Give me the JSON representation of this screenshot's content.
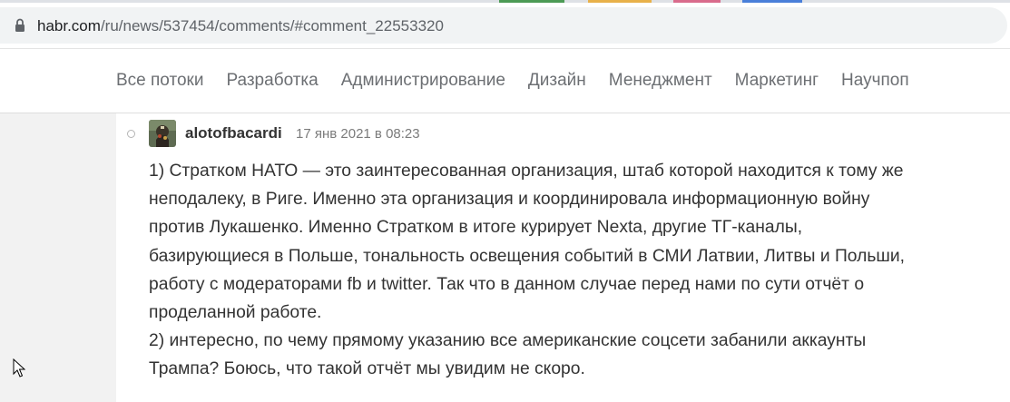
{
  "browser": {
    "url_host": "habr.com",
    "url_path": "/ru/news/537454/comments/#comment_22553320"
  },
  "nav": {
    "items": [
      "Все потоки",
      "Разработка",
      "Администрирование",
      "Дизайн",
      "Менеджмент",
      "Маркетинг",
      "Научпоп"
    ]
  },
  "comment": {
    "username": "alotofbacardi",
    "timestamp": "17 янв 2021 в 08:23",
    "lines": [
      "1) Стратком НАТО — это заинтересованная организация, штаб которой находится к тому же",
      "неподалеку, в Риге. Именно эта организация и координировала информационную войну",
      "против Лукашенко. Именно Стратком в итоге курирует Nexta, другие ТГ-каналы,",
      "базирующиеся в Польше, тональность освещения событий в СМИ Латвии, Литвы и Польши,",
      "работу с модераторами fb и twitter. Так что в данном случае перед нами по сути отчёт о",
      "проделанной работе.",
      "2) интересно, по чему прямому указанию все американские соцсети забанили аккаунты",
      "Трампа? Боюсь, что такой отчёт мы увидим не скоро."
    ]
  },
  "colors": {
    "nav_text": "#6c6f73",
    "body_text": "#333333",
    "timestamp_text": "#7b7b7b"
  }
}
